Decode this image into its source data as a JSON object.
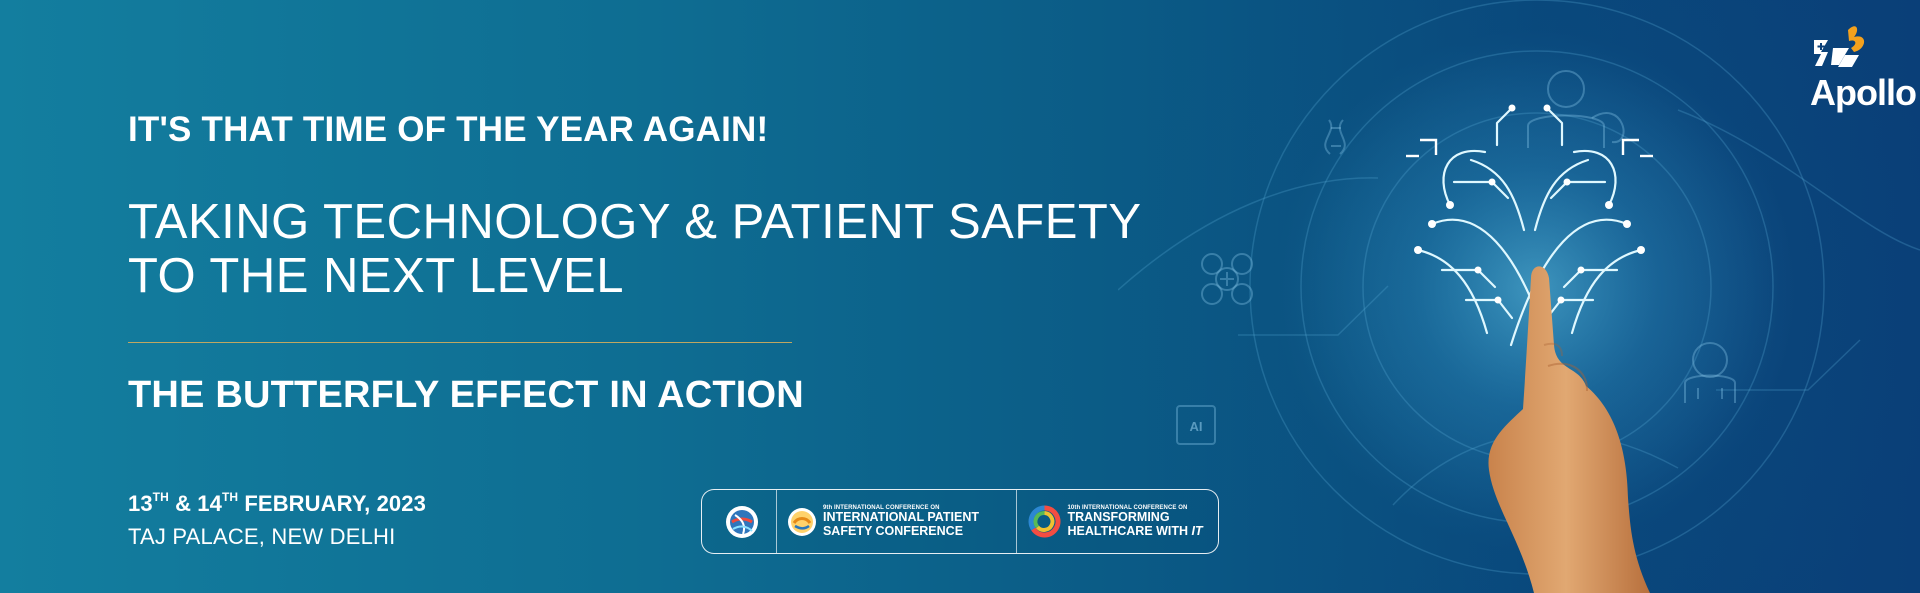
{
  "banner": {
    "kicker": "IT'S THAT TIME OF THE YEAR AGAIN!",
    "headline_line1": "TAKING TECHNOLOGY & PATIENT SAFETY",
    "headline_line2": "TO THE NEXT LEVEL",
    "tagline": "THE BUTTERFLY EFFECT IN ACTION",
    "date_prefix": "13",
    "date_first_suffix": "TH",
    "date_connector": " & 14",
    "date_second_suffix": "TH",
    "date_rest": " FEBRUARY, 2023",
    "venue": "TAJ PALACE, NEW DELHI",
    "brand_name": "Apollo",
    "art_label": "AI"
  },
  "conferences": {
    "patient_safety_small": "9th INTERNATIONAL CONFERENCE ON",
    "patient_safety_title_line1": "INTERNATIONAL PATIENT",
    "patient_safety_title_line2": "SAFETY CONFERENCE",
    "tech_small": "10th INTERNATIONAL CONFERENCE ON",
    "tech_title_line1": "TRANSFORMING",
    "tech_title_line2_prefix": "HEALTHCARE WITH ",
    "tech_title_line2_emphasis": "IT"
  },
  "colors": {
    "gradient_left": "#137e9f",
    "gradient_mid": "#0b5b86",
    "gradient_right": "#0a3f78",
    "divider": "#c9aa5f",
    "text": "#ffffff",
    "logo_orange": "#f4a11d",
    "art_glow": "#66d8ff",
    "skin": "#dca06a"
  },
  "icons": {
    "logo_icon": "apollo-mark-icon",
    "network_icon": "doctor-and-healthcare-network-icon",
    "conference_1_icon": "globe-seal-icon",
    "conference_2_icon": "patient-safety-seal-icon",
    "conference_3_icon": "rainbow-circle-icon"
  }
}
